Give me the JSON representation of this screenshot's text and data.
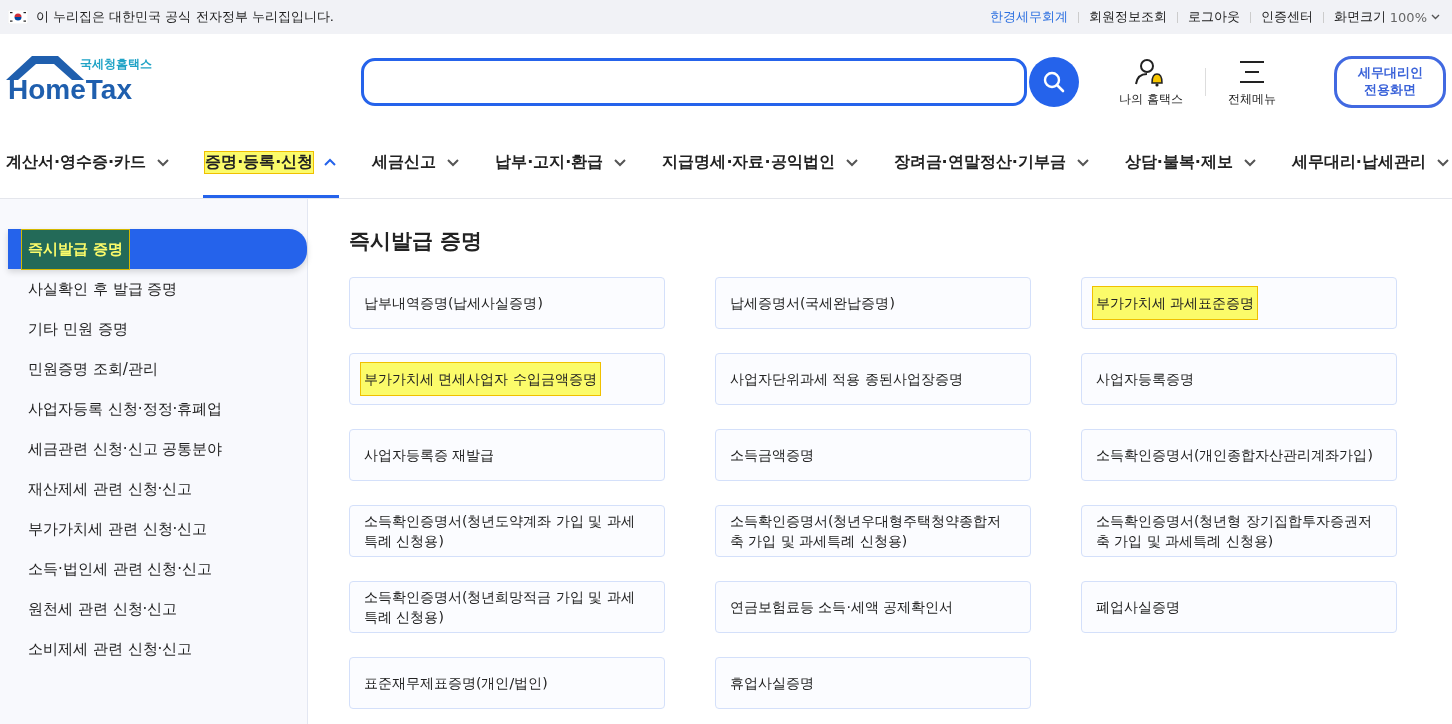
{
  "gov_banner": {
    "text": "이 누리집은 대한민국 공식 전자정부 누리집입니다."
  },
  "utility_links": [
    {
      "label": "한경세무회계",
      "kind": "account"
    },
    {
      "label": "회원정보조회",
      "kind": "link"
    },
    {
      "label": "로그아웃",
      "kind": "link"
    },
    {
      "label": "인증센터",
      "kind": "link"
    }
  ],
  "zoom": {
    "label": "화면크기",
    "value": "100%"
  },
  "logo": {
    "subtitle": "국세청홈택스",
    "title": "HomeTax"
  },
  "header_actions": [
    {
      "label": "나의 홈택스",
      "kind": "user"
    },
    {
      "label": "전체메뉴",
      "kind": "menu"
    }
  ],
  "agent_button": {
    "lines": [
      "세무대리인",
      "전용화면"
    ]
  },
  "nav": [
    {
      "label": "계산서·영수증·카드",
      "selected": false,
      "highlighted": false
    },
    {
      "label": "증명·등록·신청",
      "selected": true,
      "highlighted": true
    },
    {
      "label": "세금신고",
      "selected": false,
      "highlighted": false
    },
    {
      "label": "납부·고지·환급",
      "selected": false,
      "highlighted": false
    },
    {
      "label": "지급명세·자료·공익법인",
      "selected": false,
      "highlighted": false
    },
    {
      "label": "장려금·연말정산·기부금",
      "selected": false,
      "highlighted": false
    },
    {
      "label": "상담·불복·제보",
      "selected": false,
      "highlighted": false
    },
    {
      "label": "세무대리·납세관리",
      "selected": false,
      "highlighted": false
    }
  ],
  "sidebar": {
    "items": [
      {
        "label": "즉시발급 증명",
        "selected": true,
        "highlighted": true
      },
      {
        "label": "사실확인 후 발급 증명",
        "selected": false,
        "highlighted": false
      },
      {
        "label": "기타 민원 증명",
        "selected": false,
        "highlighted": false
      },
      {
        "label": "민원증명 조회/관리",
        "selected": false,
        "highlighted": false
      },
      {
        "label": "사업자등록 신청·정정·휴폐업",
        "selected": false,
        "highlighted": false
      },
      {
        "label": "세금관련 신청·신고 공통분야",
        "selected": false,
        "highlighted": false
      },
      {
        "label": "재산제세 관련 신청·신고",
        "selected": false,
        "highlighted": false
      },
      {
        "label": "부가가치세 관련 신청·신고",
        "selected": false,
        "highlighted": false
      },
      {
        "label": "소득·법인세 관련 신청·신고",
        "selected": false,
        "highlighted": false
      },
      {
        "label": "원천세 관련 신청·신고",
        "selected": false,
        "highlighted": false
      },
      {
        "label": "소비제세 관련 신청·신고",
        "selected": false,
        "highlighted": false
      }
    ]
  },
  "content": {
    "title": "즉시발급 증명",
    "cards": [
      {
        "label": "납부내역증명(납세사실증명)",
        "highlighted": false
      },
      {
        "label": "납세증명서(국세완납증명)",
        "highlighted": false
      },
      {
        "label": "부가가치세 과세표준증명",
        "highlighted": true
      },
      {
        "label": "부가가치세 면세사업자 수입금액증명",
        "highlighted": true
      },
      {
        "label": "사업자단위과세 적용 종된사업장증명",
        "highlighted": false
      },
      {
        "label": "사업자등록증명",
        "highlighted": false
      },
      {
        "label": "사업자등록증 재발급",
        "highlighted": false
      },
      {
        "label": "소득금액증명",
        "highlighted": false
      },
      {
        "label": "소득확인증명서(개인종합자산관리계좌가입)",
        "highlighted": false
      },
      {
        "label": "소득확인증명서(청년도약계좌 가입 및 과세특례 신청용)",
        "highlighted": false
      },
      {
        "label": "소득확인증명서(청년우대형주택청약종합저축 가입 및 과세특례 신청용)",
        "highlighted": false
      },
      {
        "label": "소득확인증명서(청년형 장기집합투자증권저축 가입 및 과세특례 신청용)",
        "highlighted": false
      },
      {
        "label": "소득확인증명서(청년희망적금 가입 및 과세특례 신청용)",
        "highlighted": false
      },
      {
        "label": "연금보험료등 소득·세액 공제확인서",
        "highlighted": false
      },
      {
        "label": "폐업사실증명",
        "highlighted": false
      },
      {
        "label": "표준재무제표증명(개인/법인)",
        "highlighted": false
      },
      {
        "label": "휴업사실증명",
        "highlighted": false
      }
    ]
  }
}
